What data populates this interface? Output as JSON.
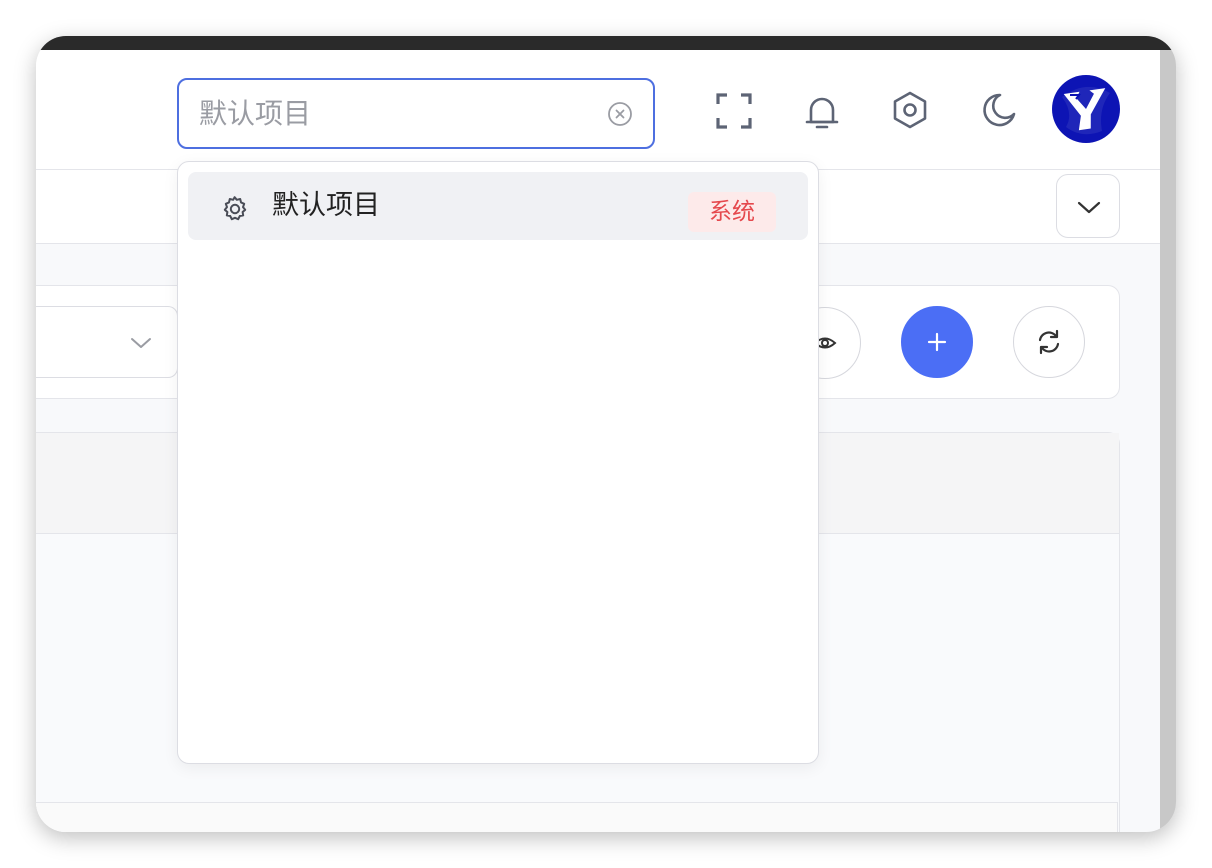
{
  "search": {
    "placeholder": "默认项目",
    "value": ""
  },
  "header_icons": [
    "fullscreen-icon",
    "bell-icon",
    "settings-hex-icon",
    "moon-icon"
  ],
  "avatar": {
    "letter": "Y"
  },
  "dropdown": {
    "options": [
      {
        "label": "默认项目",
        "badge": "系统",
        "icon": "gear-icon"
      }
    ]
  },
  "colors": {
    "accent": "#4b6ef5",
    "badge_bg": "#fdeaea",
    "badge_text": "#e5484d",
    "avatar_bg": "#0d14b4"
  }
}
